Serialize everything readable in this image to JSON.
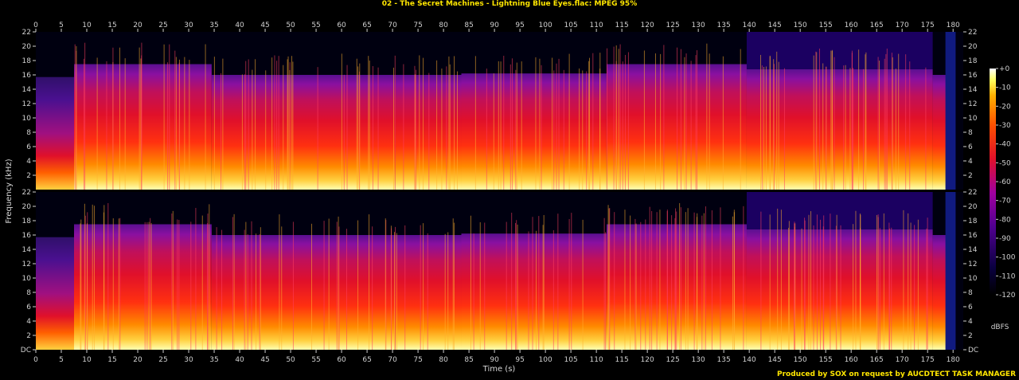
{
  "header": {
    "title": "02 - The Secret Machines - Lightning Blue Eyes.flac: MPEG 95%"
  },
  "footer": {
    "credit": "Produced by SOX on request by AUCDTECT TASK MANAGER"
  },
  "chart_data": {
    "type": "heatmap",
    "title": "02 - The Secret Machines - Lightning Blue Eyes.flac: MPEG 95%",
    "xlabel": "Time (s)",
    "ylabel": "Frequency (kHz)",
    "xlim": [
      0,
      182
    ],
    "ylim": [
      0,
      22
    ],
    "x_ticks": [
      "0",
      "5",
      "10",
      "15",
      "20",
      "25",
      "30",
      "35",
      "40",
      "45",
      "50",
      "55",
      "60",
      "65",
      "70",
      "75",
      "80",
      "85",
      "90",
      "95",
      "100",
      "105",
      "110",
      "115",
      "120",
      "125",
      "130",
      "135",
      "140",
      "145",
      "150",
      "155",
      "160",
      "165",
      "170",
      "175",
      "180"
    ],
    "y_ticks": [
      "DC",
      "2",
      "4",
      "6",
      "8",
      "10",
      "12",
      "14",
      "16",
      "18",
      "20",
      "22"
    ],
    "channels": [
      "left",
      "right"
    ],
    "colorbar": {
      "label": "dBFS",
      "ticks": [
        "+0",
        "-10",
        "-20",
        "-30",
        "-40",
        "-50",
        "-60",
        "-70",
        "-80",
        "-90",
        "-100",
        "-110",
        "-120"
      ],
      "range": [
        -120,
        0
      ]
    },
    "segments_cutoff_khz": [
      {
        "start": 0,
        "end": 7.5,
        "cutoff": 15.7
      },
      {
        "start": 7.5,
        "end": 34.5,
        "cutoff": 17.5
      },
      {
        "start": 34.5,
        "end": 70.5,
        "cutoff": 16
      },
      {
        "start": 70.5,
        "end": 83.5,
        "cutoff": 16
      },
      {
        "start": 83.5,
        "end": 112,
        "cutoff": 16.2
      },
      {
        "start": 112,
        "end": 139.5,
        "cutoff": 17.5
      },
      {
        "start": 139.5,
        "end": 176,
        "cutoff": 16.8
      },
      {
        "start": 176,
        "end": 180,
        "cutoff": 16
      }
    ],
    "colors": {
      "low": "#000040",
      "mid_low": "#6a0fa0",
      "mid": "#e0102a",
      "mid_high": "#ff7a00",
      "high": "#ffff80"
    }
  }
}
